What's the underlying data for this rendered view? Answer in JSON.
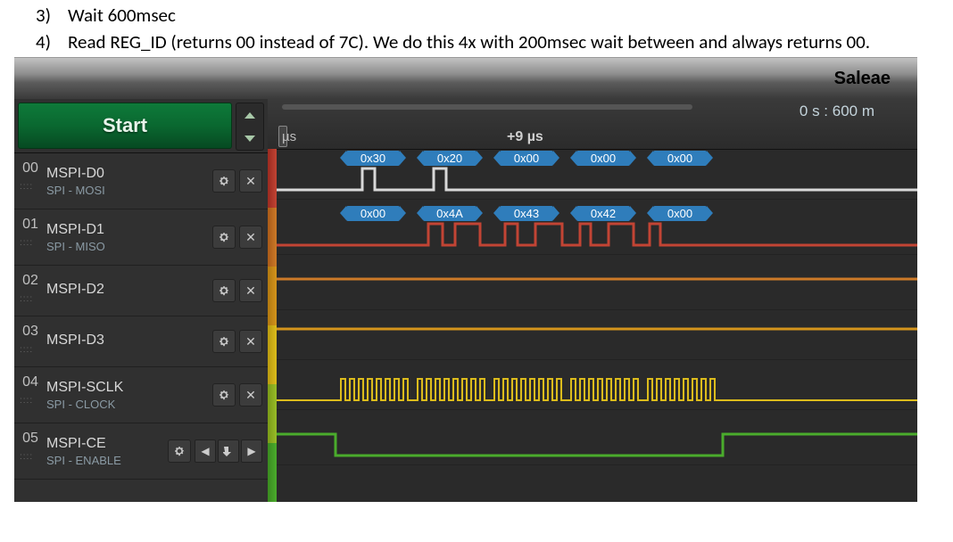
{
  "doc": {
    "line3_num": "3)",
    "line3_text": "Wait 600msec",
    "line4_num": "4)",
    "line4_text": "Read REG_ID (returns 00 instead of 7C).  We do this 4x with 200msec wait between and always returns 00."
  },
  "app": {
    "title": "Saleae",
    "start_label": "Start",
    "time_indicator": "0 s : 600 m",
    "ruler_left_unit": "µs",
    "ruler_center": "+9 µs"
  },
  "channels": [
    {
      "index": "00",
      "name": "MSPI-D0",
      "sub": "SPI - MOSI",
      "has_close": true,
      "has_trigger": false
    },
    {
      "index": "01",
      "name": "MSPI-D1",
      "sub": "SPI - MISO",
      "has_close": true,
      "has_trigger": false
    },
    {
      "index": "02",
      "name": "MSPI-D2",
      "sub": "",
      "has_close": true,
      "has_trigger": false
    },
    {
      "index": "03",
      "name": "MSPI-D3",
      "sub": "",
      "has_close": true,
      "has_trigger": false
    },
    {
      "index": "04",
      "name": "MSPI-SCLK",
      "sub": "SPI - CLOCK",
      "has_close": true,
      "has_trigger": false
    },
    {
      "index": "05",
      "name": "MSPI-CE",
      "sub": "SPI - ENABLE",
      "has_close": false,
      "has_trigger": true
    }
  ],
  "mosi_bytes": [
    "0x30",
    "0x20",
    "0x00",
    "0x00",
    "0x00"
  ],
  "miso_bytes": [
    "0x00",
    "0x4A",
    "0x43",
    "0x42",
    "0x00"
  ]
}
